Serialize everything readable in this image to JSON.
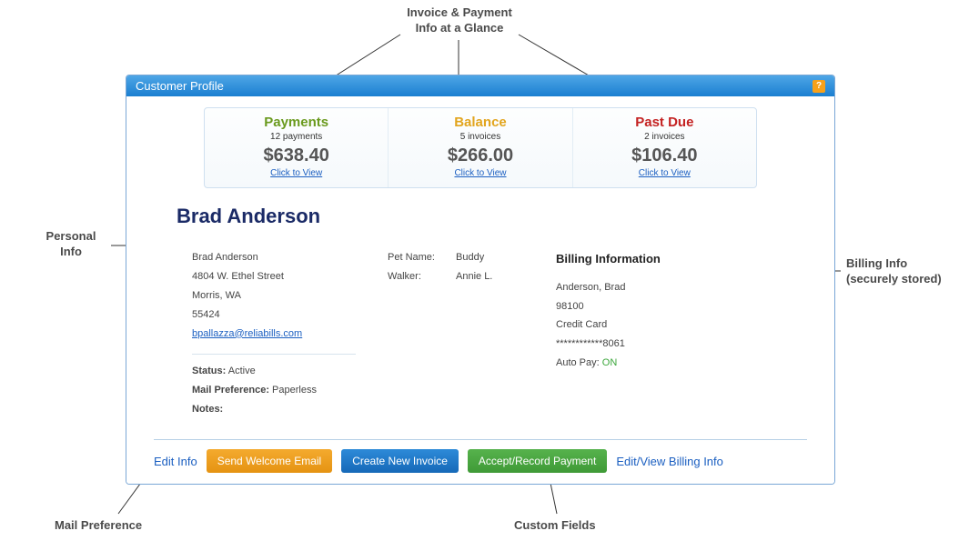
{
  "annotations": {
    "top": "Invoice & Payment\nInfo at a Glance",
    "left_personal": "Personal\nInfo",
    "right_billing": "Billing Info\n(securely stored)",
    "bottom_mail": "Mail Preference",
    "bottom_custom": "Custom Fields"
  },
  "window": {
    "title": "Customer Profile",
    "help_glyph": "?"
  },
  "stats": {
    "payments": {
      "title": "Payments",
      "sub": "12 payments",
      "amount": "$638.40",
      "link": "Click to View"
    },
    "balance": {
      "title": "Balance",
      "sub": "5 invoices",
      "amount": "$266.00",
      "link": "Click to View"
    },
    "pastdue": {
      "title": "Past Due",
      "sub": "2 invoices",
      "amount": "$106.40",
      "link": "Click to View"
    }
  },
  "customer": {
    "display_name": "Brad Anderson",
    "name": "Brad Anderson",
    "street": "4804 W. Ethel Street",
    "city_state": "Morris, WA",
    "postal": "55424",
    "email": "bpallazza@reliabills.com",
    "status_label": "Status:",
    "status_value": "Active",
    "mail_label": "Mail Preference:",
    "mail_value": "Paperless",
    "notes_label": "Notes:"
  },
  "custom_fields": {
    "row1_label": "Pet Name:",
    "row1_value": "Buddy",
    "row2_label": "Walker:",
    "row2_value": "Annie L."
  },
  "billing": {
    "heading": "Billing Information",
    "name": "Anderson, Brad",
    "code": "98100",
    "method": "Credit Card",
    "masked": "************8061",
    "autopay_label": "Auto Pay:",
    "autopay_value": "ON"
  },
  "footer": {
    "edit_info": "Edit Info",
    "send_welcome": "Send Welcome Email",
    "create_invoice": "Create New Invoice",
    "accept_payment": "Accept/Record Payment",
    "edit_billing": "Edit/View Billing Info"
  }
}
